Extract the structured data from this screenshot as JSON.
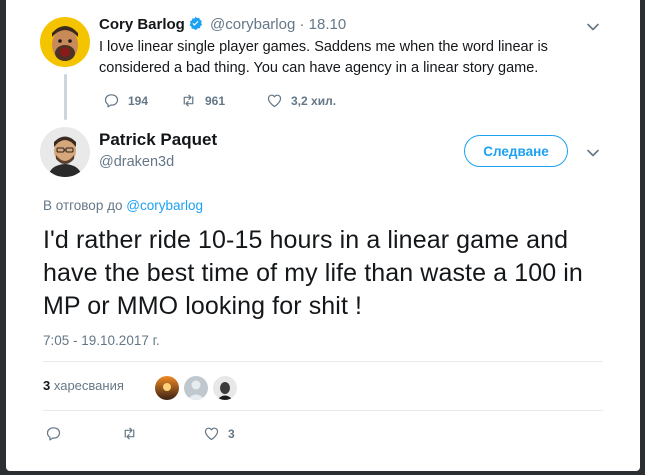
{
  "parent_tweet": {
    "name": "Cory Barlog",
    "handle": "@corybarlog",
    "separator": "·",
    "date": "18.10",
    "text": "I love linear single player games. Saddens me when the word linear is considered a bad thing. You can have agency in a linear story game.",
    "reply_count": "194",
    "retweet_count": "961",
    "like_count": "3,2 хил."
  },
  "main_tweet": {
    "name": "Patrick Paquet",
    "handle": "@draken3d",
    "follow_label": "Следване",
    "reply_prefix": "В отговор до",
    "reply_to": "@corybarlog",
    "text": "I'd rather ride 10-15 hours in a linear game and have the best time of my life than waste a 100 in MP or MMO looking for shit !",
    "timestamp": "7:05 - 19.10.2017 г.",
    "retweets_count": "3",
    "retweets_label": "харесвания",
    "like_count": "3"
  },
  "colors": {
    "accent": "#1da1f2",
    "muted": "#657786",
    "divider": "#e6ecf0",
    "avatar_yellow": "#f5c400"
  },
  "icons": [
    "verified-badge-icon",
    "chevron-down-icon",
    "reply-icon",
    "retweet-icon",
    "heart-icon"
  ]
}
